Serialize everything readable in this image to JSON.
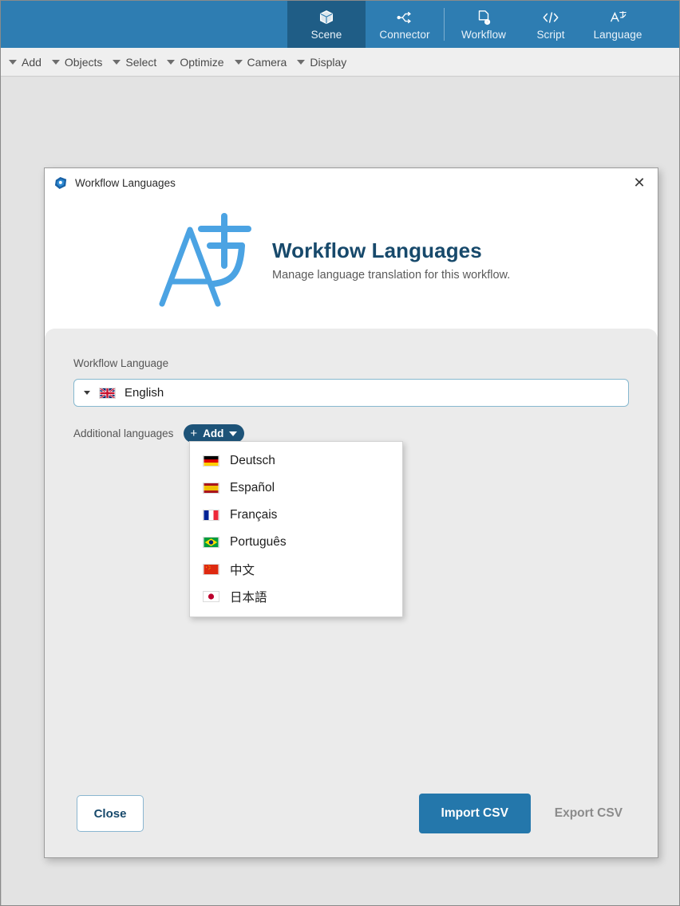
{
  "toolbar": {
    "tabs": [
      {
        "label": "Scene",
        "icon": "cube-icon",
        "active": true
      },
      {
        "label": "Connector",
        "icon": "connector-icon",
        "active": false
      },
      {
        "label": "Workflow",
        "icon": "workflow-icon",
        "active": false
      },
      {
        "label": "Script",
        "icon": "code-icon",
        "active": false
      },
      {
        "label": "Language",
        "icon": "translate-icon",
        "active": false
      }
    ]
  },
  "menubar": {
    "items": [
      {
        "label": "Add"
      },
      {
        "label": "Objects"
      },
      {
        "label": "Select"
      },
      {
        "label": "Optimize"
      },
      {
        "label": "Camera"
      },
      {
        "label": "Display"
      }
    ]
  },
  "dialog": {
    "titlebar_text": "Workflow Languages",
    "close_glyph": "✕",
    "header": {
      "title": "Workflow Languages",
      "subtitle": "Manage language translation for this workflow.",
      "icon": "translate-large-icon"
    },
    "workflow_language": {
      "label": "Workflow Language",
      "selected": "English",
      "flag": "flag-gb"
    },
    "additional_languages": {
      "label": "Additional languages",
      "add_button_label": "Add",
      "add_button_plus": "+",
      "options": [
        {
          "label": "Deutsch",
          "flag": "flag-de"
        },
        {
          "label": "Español",
          "flag": "flag-es"
        },
        {
          "label": "Français",
          "flag": "flag-fr"
        },
        {
          "label": "Português",
          "flag": "flag-br"
        },
        {
          "label": "中文",
          "flag": "flag-cn"
        },
        {
          "label": "日本語",
          "flag": "flag-jp"
        }
      ]
    },
    "footer": {
      "close_label": "Close",
      "import_label": "Import CSV",
      "export_label": "Export CSV"
    }
  },
  "colors": {
    "tabbar_blue": "#2e7db2",
    "tab_active_blue": "#1f5d86",
    "primary_button": "#2477ab",
    "add_button": "#1d5378",
    "title_navy": "#17496b",
    "icon_light_blue": "#45a0dc",
    "body_gray": "#ebebeb"
  }
}
